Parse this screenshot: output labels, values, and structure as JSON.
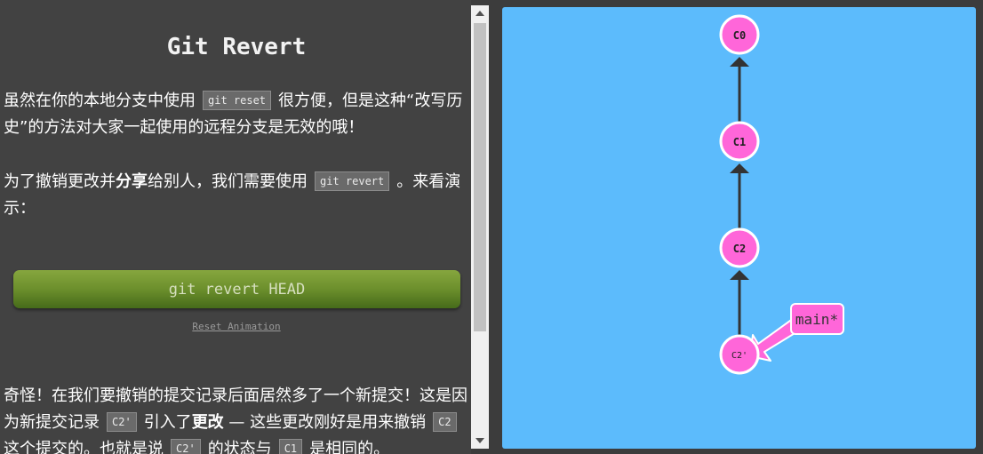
{
  "lesson": {
    "title": "Git Revert",
    "p1": {
      "part1": "虽然在你的本地分支中使用",
      "code1": "git reset",
      "part2": "很方便，但是这种“改写历史”的方法对大家一起使用的远程分支是无效的哦！"
    },
    "p2": {
      "part1": "为了撤销更改并",
      "bold1": "分享",
      "part2": "给别人，我们需要使用",
      "code1": "git revert",
      "part3": "。来看演示："
    },
    "button_label": "git revert HEAD",
    "reset_label": "Reset Animation",
    "p3": {
      "part1": "奇怪！在我们要撤销的提交记录后面居然多了一个新提交！这是因为新提交记录",
      "code1": "C2'",
      "part2": "引入了",
      "bold1": "更改",
      "part3": " — 这些更改刚好是用来撤销",
      "code2": "C2",
      "part4": "这个提交的。也就是说",
      "code3": "C2'",
      "part5": "的状态与",
      "code4": "C1",
      "part6": "是相同的。"
    }
  },
  "graph": {
    "commits": [
      {
        "id": "C0",
        "label": "C0"
      },
      {
        "id": "C1",
        "label": "C1"
      },
      {
        "id": "C2",
        "label": "C2"
      },
      {
        "id": "C2p",
        "label": "C2'"
      }
    ],
    "edges": [
      {
        "from": "C1",
        "to": "C0"
      },
      {
        "from": "C2",
        "to": "C1"
      },
      {
        "from": "C2p",
        "to": "C2"
      }
    ],
    "branch": {
      "label": "main*",
      "target": "C2p"
    },
    "colors": {
      "background": "#5cbbfc",
      "commit_fill": "#ff66d9",
      "commit_stroke": "#ffffff",
      "edge": "#333333",
      "branch_fill": "#ff66d9"
    }
  }
}
